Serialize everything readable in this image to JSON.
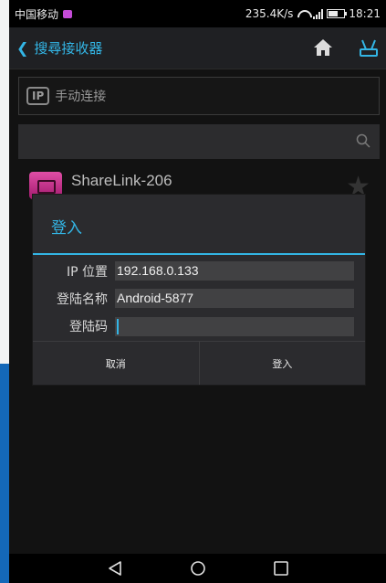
{
  "status_bar": {
    "carrier": "中国移动",
    "speed": "235.4K/s",
    "time": "18:21"
  },
  "action_bar": {
    "title": "搜尋接收器"
  },
  "manual_connect": {
    "badge": "IP",
    "label": "手动连接"
  },
  "search": {
    "value": ""
  },
  "device": {
    "name": "ShareLink-206"
  },
  "dialog": {
    "title": "登入",
    "fields": [
      {
        "label": "IP 位置",
        "value": "192.168.0.133"
      },
      {
        "label": "登陆名称",
        "value": "Android-5877"
      },
      {
        "label": "登陆码",
        "value": ""
      }
    ],
    "cancel_label": "取消",
    "login_label": "登入"
  },
  "colors": {
    "accent": "#33b5e5",
    "background": "#121212",
    "dialog": "#2b2b2e",
    "device_icon": "#d63b95"
  }
}
